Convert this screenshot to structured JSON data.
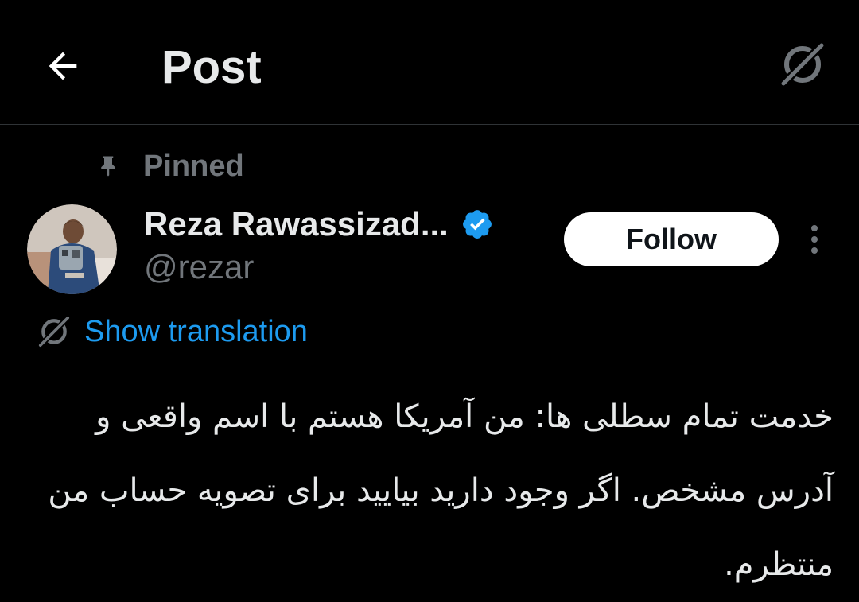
{
  "header": {
    "title": "Post",
    "back_icon": "arrow-left-icon",
    "grok_icon": "grok-icon"
  },
  "post": {
    "pinned_label": "Pinned",
    "pin_icon": "pin-icon",
    "author": {
      "display_name": "Reza Rawassizad...",
      "handle": "@rezar",
      "verified": true
    },
    "follow_label": "Follow",
    "more_icon": "more-vertical-icon",
    "translation_label": "Show translation",
    "text": "خدمت تمام سطلی ها: من آمریکا هستم با اسم واقعی و آدرس مشخص. اگر وجود دارید بیایید برای تصویه حساب من منتظرم."
  },
  "colors": {
    "background": "#000000",
    "text_primary": "#e7e9ea",
    "text_secondary": "#71767b",
    "accent_blue": "#1d9bf0",
    "divider": "#2f3336"
  }
}
